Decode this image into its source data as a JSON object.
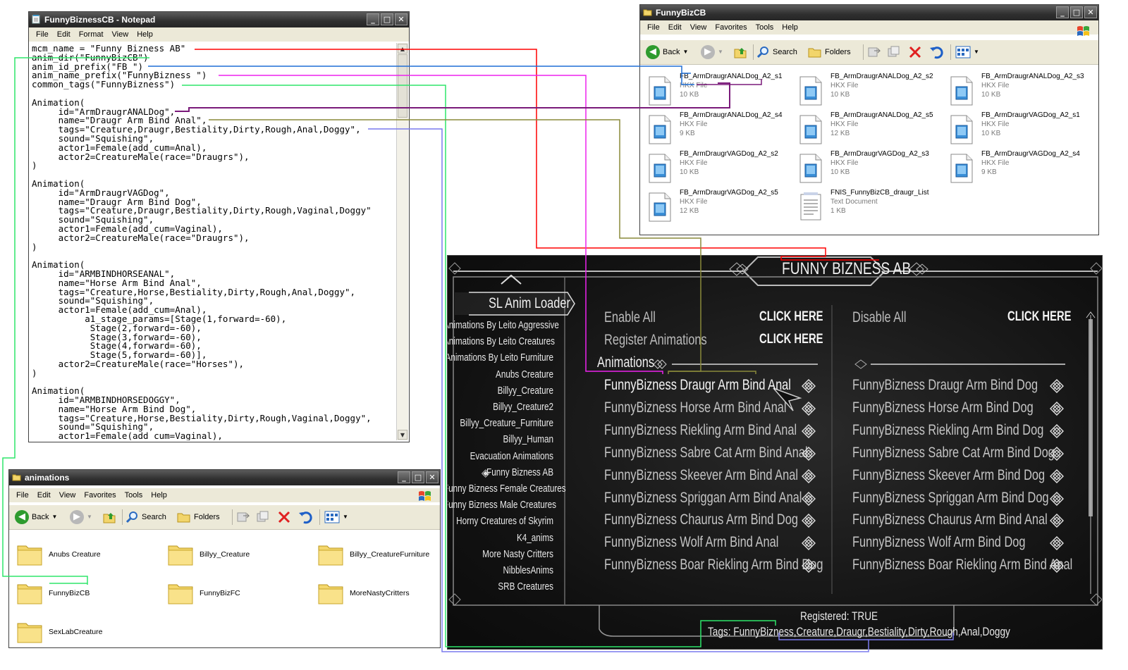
{
  "notepad": {
    "title": "FunnyBiznessCB - Notepad",
    "menu": [
      "File",
      "Edit",
      "Format",
      "View",
      "Help"
    ],
    "lines": [
      "mcm_name = \"Funny Bizness AB\"",
      "anim_dir(\"FunnyBizCB\")",
      "anim_id_prefix(\"FB_\")",
      "anim_name_prefix(\"FunnyBizness \")",
      "common_tags(\"FunnyBizness\")",
      "",
      "Animation(",
      "     id=\"ArmDraugrANALDog\",",
      "     name=\"Draugr Arm Bind Anal\",",
      "     tags=\"Creature,Draugr,Bestiality,Dirty,Rough,Anal,Doggy\",",
      "     sound=\"Squishing\",",
      "     actor1=Female(add_cum=Anal),",
      "     actor2=CreatureMale(race=\"Draugrs\"),",
      ")",
      "",
      "Animation(",
      "     id=\"ArmDraugrVAGDog\",",
      "     name=\"Draugr Arm Bind Dog\",",
      "     tags=\"Creature,Draugr,Bestiality,Dirty,Rough,Vaginal,Doggy\"",
      "     sound=\"Squishing\",",
      "     actor1=Female(add_cum=Vaginal),",
      "     actor2=CreatureMale(race=\"Draugrs\"),",
      ")",
      "",
      "Animation(",
      "     id=\"ARMBINDHORSEANAL\",",
      "     name=\"Horse Arm Bind Anal\",",
      "     tags=\"Creature,Horse,Bestiality,Dirty,Rough,Anal,Doggy\",",
      "     sound=\"Squishing\",",
      "     actor1=Female(add_cum=Anal),",
      "          a1_stage_params=[Stage(1,forward=-60),",
      "           Stage(2,forward=-60),",
      "           Stage(3,forward=-60),",
      "           Stage(4,forward=-60),",
      "           Stage(5,forward=-60)],",
      "     actor2=CreatureMale(race=\"Horses\"),",
      ")",
      "",
      "Animation(",
      "     id=\"ARMBINDHORSEDOGGY\",",
      "     name=\"Horse Arm Bind Dog\",",
      "     tags=\"Creature,Horse,Bestiality,Dirty,Rough,Vaginal,Doggy\",",
      "     sound=\"Squishing\",",
      "     actor1=Female(add_cum=Vaginal),"
    ]
  },
  "explorer_top": {
    "title": "FunnyBizCB",
    "menu": [
      "File",
      "Edit",
      "View",
      "Favorites",
      "Tools",
      "Help"
    ],
    "toolbar": {
      "back": "Back",
      "search": "Search",
      "folders": "Folders"
    },
    "files": [
      {
        "name": "FB_ArmDraugrANALDog_A2_s1",
        "type": "HKX File",
        "size": "10 KB"
      },
      {
        "name": "FB_ArmDraugrANALDog_A2_s2",
        "type": "HKX File",
        "size": "10 KB"
      },
      {
        "name": "FB_ArmDraugrANALDog_A2_s3",
        "type": "HKX File",
        "size": "10 KB"
      },
      {
        "name": "FB_ArmDraugrANALDog_A2_s4",
        "type": "HKX File",
        "size": "9 KB"
      },
      {
        "name": "FB_ArmDraugrANALDog_A2_s5",
        "type": "HKX File",
        "size": "12 KB"
      },
      {
        "name": "FB_ArmDraugrVAGDog_A2_s1",
        "type": "HKX File",
        "size": "10 KB"
      },
      {
        "name": "FB_ArmDraugrVAGDog_A2_s2",
        "type": "HKX File",
        "size": "10 KB"
      },
      {
        "name": "FB_ArmDraugrVAGDog_A2_s3",
        "type": "HKX File",
        "size": "10 KB"
      },
      {
        "name": "FB_ArmDraugrVAGDog_A2_s4",
        "type": "HKX File",
        "size": "9 KB"
      },
      {
        "name": "FB_ArmDraugrVAGDog_A2_s5",
        "type": "HKX File",
        "size": "12 KB"
      },
      {
        "name": "FNIS_FunnyBizCB_draugr_List",
        "type": "Text Document",
        "size": "1 KB"
      }
    ]
  },
  "explorer_bottom": {
    "title": "animations",
    "menu": [
      "File",
      "Edit",
      "View",
      "Favorites",
      "Tools",
      "Help"
    ],
    "toolbar": {
      "back": "Back",
      "search": "Search",
      "folders": "Folders"
    },
    "folders": [
      "Anubs Creature",
      "Billyy_Creature",
      "Billyy_CreatureFurniture",
      "FunnyBizCB",
      "FunnyBizFC",
      "MoreNastyCritters",
      "SexLabCreature"
    ]
  },
  "mcm": {
    "header": "FUNNY BIZNESS AB",
    "sidebar_title": "SL Anim Loader",
    "sidebar_items": [
      "Animations By Leito Aggressive",
      "Animations By Leito Creatures",
      "Animations By Leito Furniture",
      "Anubs Creature",
      "Billyy_Creature",
      "Billyy_Creature2",
      "Billyy_Creature_Furniture",
      "Billyy_Human",
      "Evacuation Animations",
      "Funny Bizness AB",
      "Funny Bizness Female Creatures",
      "Funny Bizness Male Creatures",
      "Horny Creatures of Skyrim",
      "K4_anims",
      "More Nasty Critters",
      "NibblesAnims",
      "SRB Creatures"
    ],
    "enable_all": "Enable All",
    "disable_all": "Disable All",
    "register_animations": "Register Animations",
    "click_here": "CLICK HERE",
    "animations_header": "Animations",
    "left_anims": [
      "FunnyBizness Draugr Arm Bind Anal",
      "FunnyBizness Horse Arm Bind Anal",
      "FunnyBizness Riekling Arm Bind Anal",
      "FunnyBizness Sabre Cat Arm Bind Anal",
      "FunnyBizness Skeever Arm Bind Anal",
      "FunnyBizness Spriggan Arm Bind Anal",
      "FunnyBizness Chaurus Arm Bind Dog",
      "FunnyBizness Wolf Arm Bind Anal",
      "FunnyBizness Boar Riekling Arm Bind Dog"
    ],
    "right_anims": [
      "FunnyBizness Draugr Arm Bind Dog",
      "FunnyBizness Horse Arm Bind Dog",
      "FunnyBizness Riekling Arm Bind Dog",
      "FunnyBizness Sabre Cat Arm Bind Dog",
      "FunnyBizness Skeever Arm Bind Dog",
      "FunnyBizness Spriggan Arm Bind Dog",
      "FunnyBizness Chaurus Arm Bind Anal",
      "FunnyBizness Wolf Arm Bind Dog",
      "FunnyBizness Boar Riekling Arm Bind Anal"
    ],
    "registered": "Registered: TRUE",
    "tags": "Tags: FunnyBizness,Creature,Draugr,Bestiality,Dirty,Rough,Anal,Doggy"
  },
  "colors": {
    "red": "#ff0000",
    "blue": "#1f6fd6",
    "magenta": "#ee22ee",
    "green": "#2ee66a",
    "purple": "#7a1a7a",
    "olive": "#8a8a3a",
    "lavender": "#7a7aee"
  }
}
